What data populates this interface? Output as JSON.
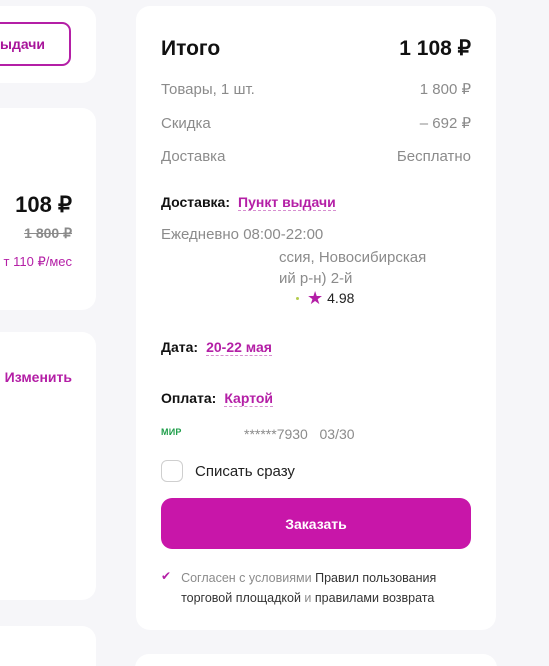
{
  "left": {
    "pickup_button": "ыдачи",
    "price": "108 ₽",
    "old_price": "1 800 ₽",
    "monthly": "т 110 ₽/мес",
    "change_link": "Изменить"
  },
  "summary": {
    "total_label": "Итого",
    "total_value": "1 108 ₽",
    "items_label": "Товары, 1 шт.",
    "items_value": "1 800 ₽",
    "discount_label": "Скидка",
    "discount_value": "– 692 ₽",
    "delivery_label": "Доставка",
    "delivery_value": "Бесплатно"
  },
  "delivery": {
    "label": "Доставка:",
    "method": "Пункт выдачи",
    "hours": "Ежедневно 08:00-22:00",
    "address_line1": "ссия, Новосибирская",
    "address_line2": "ий р-н) 2-й",
    "rating": "4.98"
  },
  "date": {
    "label": "Дата:",
    "value": "20-22 мая"
  },
  "payment": {
    "label": "Оплата:",
    "method": "Картой",
    "card_brand": "МИР",
    "card_number": "******7930   03/30"
  },
  "write_off": {
    "label": "Списать сразу"
  },
  "order_button": "Заказать",
  "agreement": {
    "prefix": "Согласен с условиями",
    "rules_link": "Правил пользования торговой площадкой",
    "and": "и",
    "return_link": "правилами возврата"
  },
  "colors": {
    "accent": "#b41fa6",
    "button": "#c816a9",
    "mir_green": "#1f9e4a"
  }
}
